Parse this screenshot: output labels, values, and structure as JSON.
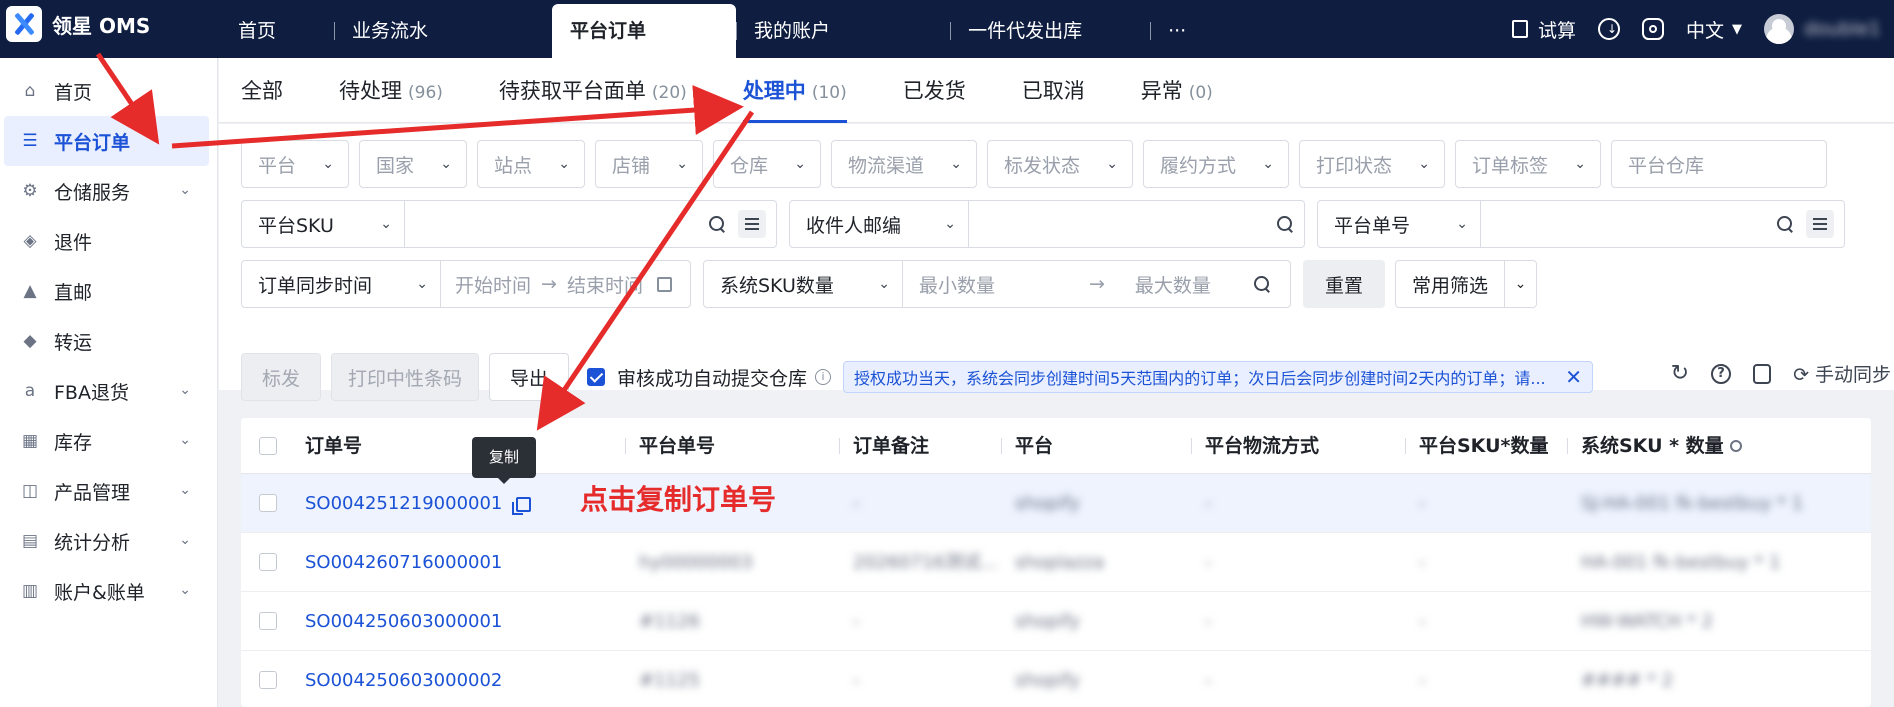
{
  "app": {
    "logo_text": "领星 OMS"
  },
  "topnav": [
    {
      "label": "首页"
    },
    {
      "label": "业务流水"
    },
    {
      "label": "平台订单"
    },
    {
      "label": "我的账户"
    },
    {
      "label": "一件代发出库"
    },
    {
      "label": "···"
    }
  ],
  "topright": {
    "trial_label": "试算",
    "lang_label": "中文",
    "username": "double1"
  },
  "sidebar": {
    "items": [
      {
        "label": "首页",
        "icon": "home-icon"
      },
      {
        "label": "平台订单",
        "icon": "list-icon"
      },
      {
        "label": "仓储服务",
        "icon": "warehouse-icon"
      },
      {
        "label": "退件",
        "icon": "box-icon"
      },
      {
        "label": "直邮",
        "icon": "mail-icon"
      },
      {
        "label": "转运",
        "icon": "transfer-icon"
      },
      {
        "label": "FBA退货",
        "icon": "amazon-icon"
      },
      {
        "label": "库存",
        "icon": "inventory-icon"
      },
      {
        "label": "产品管理",
        "icon": "bag-icon"
      },
      {
        "label": "统计分析",
        "icon": "chart-icon"
      },
      {
        "label": "账户&账单",
        "icon": "bill-icon"
      }
    ]
  },
  "tabs": [
    {
      "label": "全部",
      "count": ""
    },
    {
      "label": "待处理",
      "count": "(96)"
    },
    {
      "label": "待获取平台面单",
      "count": "(20)"
    },
    {
      "label": "处理中",
      "count": "(10)"
    },
    {
      "label": "已发货",
      "count": ""
    },
    {
      "label": "已取消",
      "count": ""
    },
    {
      "label": "异常",
      "count": "(0)"
    }
  ],
  "filters": {
    "row1": [
      "平台",
      "国家",
      "站点",
      "店铺",
      "仓库",
      "物流渠道",
      "标发状态",
      "履约方式",
      "打印状态",
      "订单标签"
    ],
    "platform_warehouse_placeholder": "平台仓库",
    "platform_sku_label": "平台SKU",
    "receiver_zip_label": "收件人邮编",
    "platform_order_label": "平台单号",
    "sync_time_label": "订单同步时间",
    "start_time_placeholder": "开始时间",
    "end_time_placeholder": "结束时间",
    "sys_sku_qty_label": "系统SKU数量",
    "min_qty_placeholder": "最小数量",
    "max_qty_placeholder": "最大数量",
    "reset_label": "重置",
    "common_filter_label": "常用筛选"
  },
  "toolbar": {
    "mark_label": "标发",
    "print_label": "打印中性条码",
    "export_label": "导出",
    "auto_submit_label": "审核成功自动提交仓库",
    "notice": "授权成功当天，系统会同步创建时间5天范围内的订单；次日后会同步创建时间2天内的订单；请...",
    "manual_sync_label": "手动同步"
  },
  "table": {
    "headers": [
      "订单号",
      "平台单号",
      "订单备注",
      "平台",
      "平台物流方式",
      "平台SKU*数量",
      "系统SKU * 数量"
    ],
    "rows": [
      [
        "SO004251219000001",
        "-",
        "-",
        "shopify",
        "-",
        "-",
        "SJ-HA-001 fk-bestbuy * 1"
      ],
      [
        "SO004260716000001",
        "hy00000003",
        "20260716测试...",
        "shoplazza",
        "-",
        "-",
        "HA-001 fk-bestbuy * 1"
      ],
      [
        "SO004250603000001",
        "#1126",
        "-",
        "shopify",
        "-",
        "-",
        "HW-WATCH * 2"
      ],
      [
        "SO004250603000002",
        "#1125",
        "-",
        "shopify",
        "-",
        "-",
        "#### * 2"
      ]
    ]
  },
  "tooltip": {
    "copy_label": "复制"
  },
  "annotation": {
    "text": "点击复制订单号",
    "color": "#e62b2b"
  },
  "colors": {
    "topbar": "#0e1d40",
    "accent": "#1b52d6",
    "annotation": "#e62b2b"
  }
}
